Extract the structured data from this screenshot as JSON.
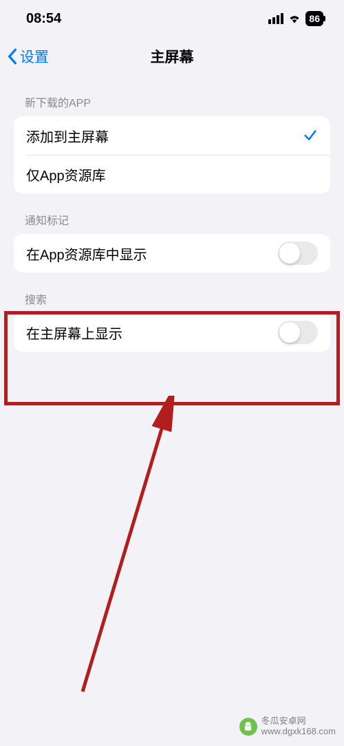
{
  "status": {
    "time": "08:54",
    "battery": "86"
  },
  "nav": {
    "back_label": "设置",
    "title": "主屏幕"
  },
  "sections": {
    "new_apps": {
      "header": "新下载的APP",
      "option_home": "添加到主屏幕",
      "option_library": "仅App资源库"
    },
    "badges": {
      "header": "通知标记",
      "show_in_library": "在App资源库中显示"
    },
    "search": {
      "header": "搜索",
      "show_on_home": "在主屏幕上显示"
    }
  },
  "watermark": {
    "line1": "冬瓜安卓网",
    "line2": "www.dgxk168.com"
  }
}
